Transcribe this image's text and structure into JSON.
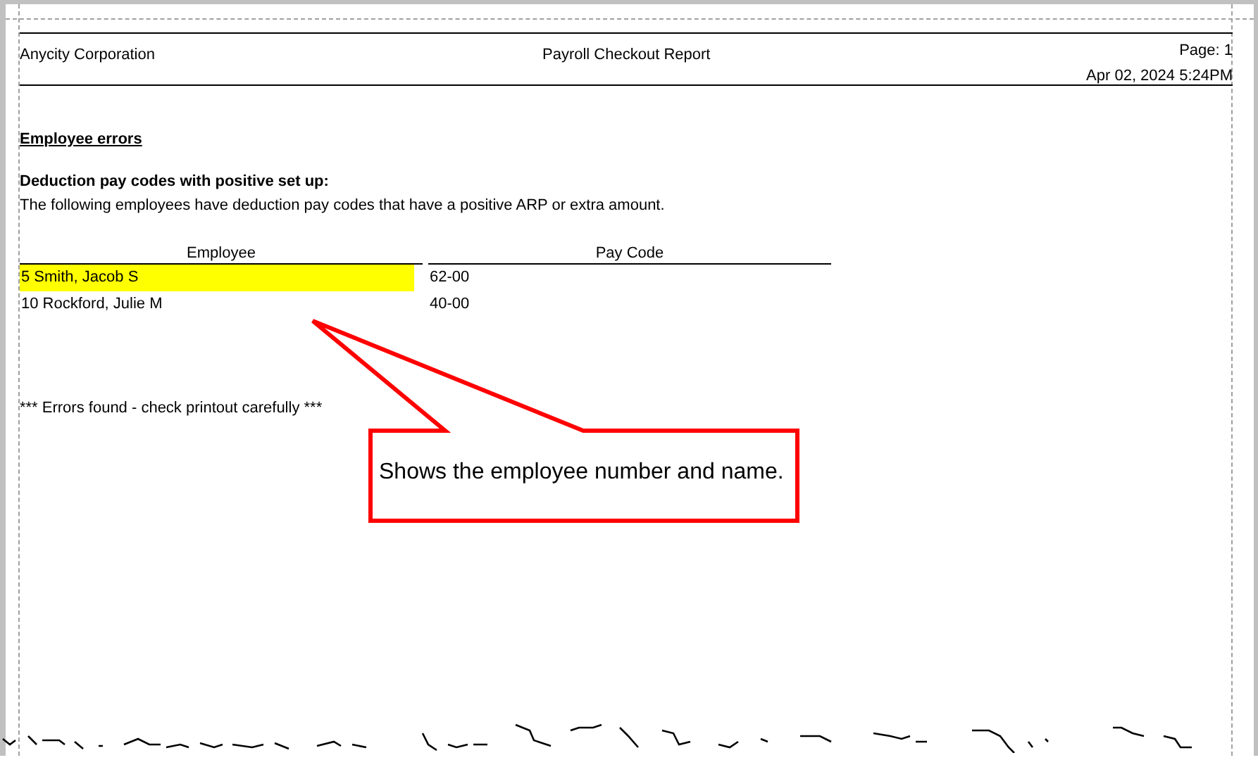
{
  "report_header": {
    "company": "Anycity Corporation",
    "title": "Payroll Checkout Report",
    "page": "Page: 1",
    "timestamp": "Apr 02, 2024 5:24PM"
  },
  "section_title": "Employee errors",
  "subsection_title": "Deduction pay codes with positive set up:",
  "description": "The following employees have deduction pay codes that have a positive ARP or extra amount.",
  "table": {
    "columns": [
      "Employee",
      "Pay Code"
    ],
    "rows": [
      {
        "employee": "5 Smith, Jacob S",
        "pay_code": "62-00",
        "highlighted": true
      },
      {
        "employee": "10 Rockford, Julie M",
        "pay_code": "40-00",
        "highlighted": false
      }
    ]
  },
  "footer_note": "*** Errors found - check printout carefully ***",
  "callout": {
    "text": "Shows the employee number and name."
  }
}
